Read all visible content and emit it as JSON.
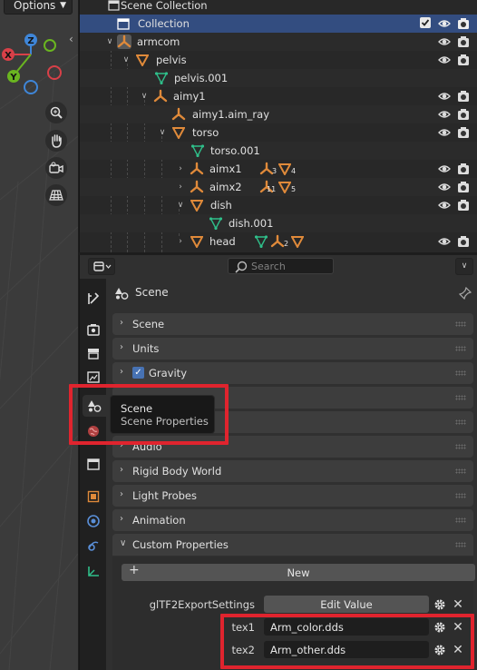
{
  "viewport": {
    "options_label": "Options",
    "gizmo_axes": [
      "Z",
      "X",
      "Y"
    ],
    "tools": [
      "zoom-icon",
      "hand-icon",
      "camera-icon",
      "grid-icon"
    ]
  },
  "outliner": {
    "rows": [
      {
        "label": "Scene Collection"
      },
      {
        "label": "Collection"
      },
      {
        "label": "armcom"
      },
      {
        "label": "pelvis"
      },
      {
        "label": "pelvis.001"
      },
      {
        "label": "aimy1"
      },
      {
        "label": "aimy1.aim_ray"
      },
      {
        "label": "torso"
      },
      {
        "label": "torso.001"
      },
      {
        "label": "aimx1",
        "badges": [
          "3",
          "4"
        ]
      },
      {
        "label": "aimx2",
        "badges": [
          "11",
          "5"
        ]
      },
      {
        "label": "dish"
      },
      {
        "label": "dish.001"
      },
      {
        "label": "head",
        "badges": [
          "2"
        ]
      }
    ]
  },
  "properties": {
    "search_placeholder": "Search",
    "context_title": "Scene",
    "panels": [
      {
        "label": "Scene"
      },
      {
        "label": "Units"
      },
      {
        "label": "Gravity",
        "checked": true
      },
      {
        "label": ""
      },
      {
        "label": "Audio"
      },
      {
        "label": "Rigid Body World"
      },
      {
        "label": "Light Probes"
      },
      {
        "label": "Animation"
      },
      {
        "label": "Custom Properties"
      }
    ],
    "custom_properties": {
      "new_label": "New",
      "items": [
        {
          "name": "glTF2ExportSettings",
          "value": "Edit Value",
          "kind": "button"
        },
        {
          "name": "tex1",
          "value": "Arm_color.dds",
          "kind": "text"
        },
        {
          "name": "tex2",
          "value": "Arm_other.dds",
          "kind": "text"
        }
      ]
    }
  },
  "tooltip": {
    "title": "Scene",
    "subtitle": "Scene Properties"
  },
  "colors": {
    "selection": "#334d80",
    "accent_blue": "#4772b3",
    "object_orange": "#e08a3a",
    "mesh_green": "#2fbf8a",
    "annotation_red": "#e0242e"
  }
}
